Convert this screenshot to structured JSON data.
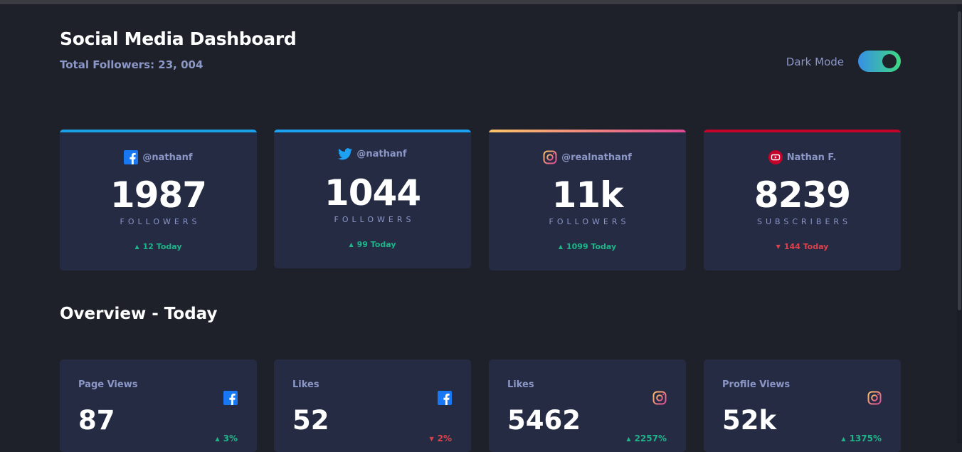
{
  "header": {
    "title": "Social Media Dashboard",
    "total_followers": "Total Followers: 23, 004",
    "dark_mode_label": "Dark Mode",
    "dark_mode_on": true
  },
  "colors": {
    "facebook": "#1877f2",
    "twitter": "#1da1f2",
    "instagram_start": "#fdc468",
    "instagram_end": "#df4996",
    "youtube": "#c4032a",
    "up": "#1db489",
    "down": "#dc414c"
  },
  "cards": [
    {
      "icon": "facebook-icon",
      "handle": "@nathanf",
      "count": "1987",
      "unit": "FOLLOWERS",
      "trend": "up",
      "delta": "12 Today"
    },
    {
      "icon": "twitter-icon",
      "handle": "@nathanf",
      "count": "1044",
      "unit": "FOLLOWERS",
      "trend": "up",
      "delta": "99 Today"
    },
    {
      "icon": "instagram-icon",
      "handle": "@realnathanf",
      "count": "11k",
      "unit": "FOLLOWERS",
      "trend": "up",
      "delta": "1099 Today"
    },
    {
      "icon": "youtube-icon",
      "handle": "Nathan F.",
      "count": "8239",
      "unit": "SUBSCRIBERS",
      "trend": "down",
      "delta": "144 Today"
    }
  ],
  "overview": {
    "title": "Overview - Today",
    "items": [
      {
        "label": "Page Views",
        "icon": "facebook-icon",
        "value": "87",
        "trend": "up",
        "percent": "3%"
      },
      {
        "label": "Likes",
        "icon": "facebook-icon",
        "value": "52",
        "trend": "down",
        "percent": "2%"
      },
      {
        "label": "Likes",
        "icon": "instagram-icon",
        "value": "5462",
        "trend": "up",
        "percent": "2257%"
      },
      {
        "label": "Profile Views",
        "icon": "instagram-icon",
        "value": "52k",
        "trend": "up",
        "percent": "1375%"
      }
    ]
  }
}
